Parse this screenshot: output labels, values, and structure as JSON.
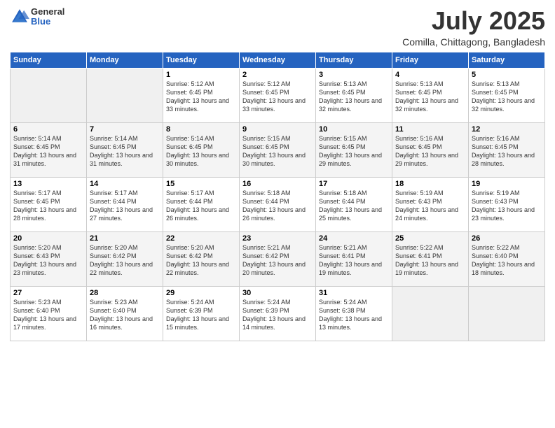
{
  "logo": {
    "general": "General",
    "blue": "Blue"
  },
  "header": {
    "title": "July 2025",
    "subtitle": "Comilla, Chittagong, Bangladesh"
  },
  "days": [
    "Sunday",
    "Monday",
    "Tuesday",
    "Wednesday",
    "Thursday",
    "Friday",
    "Saturday"
  ],
  "weeks": [
    [
      {
        "day": "",
        "sunrise": "",
        "sunset": "",
        "daylight": ""
      },
      {
        "day": "",
        "sunrise": "",
        "sunset": "",
        "daylight": ""
      },
      {
        "day": "1",
        "sunrise": "Sunrise: 5:12 AM",
        "sunset": "Sunset: 6:45 PM",
        "daylight": "Daylight: 13 hours and 33 minutes."
      },
      {
        "day": "2",
        "sunrise": "Sunrise: 5:12 AM",
        "sunset": "Sunset: 6:45 PM",
        "daylight": "Daylight: 13 hours and 33 minutes."
      },
      {
        "day": "3",
        "sunrise": "Sunrise: 5:13 AM",
        "sunset": "Sunset: 6:45 PM",
        "daylight": "Daylight: 13 hours and 32 minutes."
      },
      {
        "day": "4",
        "sunrise": "Sunrise: 5:13 AM",
        "sunset": "Sunset: 6:45 PM",
        "daylight": "Daylight: 13 hours and 32 minutes."
      },
      {
        "day": "5",
        "sunrise": "Sunrise: 5:13 AM",
        "sunset": "Sunset: 6:45 PM",
        "daylight": "Daylight: 13 hours and 32 minutes."
      }
    ],
    [
      {
        "day": "6",
        "sunrise": "Sunrise: 5:14 AM",
        "sunset": "Sunset: 6:45 PM",
        "daylight": "Daylight: 13 hours and 31 minutes."
      },
      {
        "day": "7",
        "sunrise": "Sunrise: 5:14 AM",
        "sunset": "Sunset: 6:45 PM",
        "daylight": "Daylight: 13 hours and 31 minutes."
      },
      {
        "day": "8",
        "sunrise": "Sunrise: 5:14 AM",
        "sunset": "Sunset: 6:45 PM",
        "daylight": "Daylight: 13 hours and 30 minutes."
      },
      {
        "day": "9",
        "sunrise": "Sunrise: 5:15 AM",
        "sunset": "Sunset: 6:45 PM",
        "daylight": "Daylight: 13 hours and 30 minutes."
      },
      {
        "day": "10",
        "sunrise": "Sunrise: 5:15 AM",
        "sunset": "Sunset: 6:45 PM",
        "daylight": "Daylight: 13 hours and 29 minutes."
      },
      {
        "day": "11",
        "sunrise": "Sunrise: 5:16 AM",
        "sunset": "Sunset: 6:45 PM",
        "daylight": "Daylight: 13 hours and 29 minutes."
      },
      {
        "day": "12",
        "sunrise": "Sunrise: 5:16 AM",
        "sunset": "Sunset: 6:45 PM",
        "daylight": "Daylight: 13 hours and 28 minutes."
      }
    ],
    [
      {
        "day": "13",
        "sunrise": "Sunrise: 5:17 AM",
        "sunset": "Sunset: 6:45 PM",
        "daylight": "Daylight: 13 hours and 28 minutes."
      },
      {
        "day": "14",
        "sunrise": "Sunrise: 5:17 AM",
        "sunset": "Sunset: 6:44 PM",
        "daylight": "Daylight: 13 hours and 27 minutes."
      },
      {
        "day": "15",
        "sunrise": "Sunrise: 5:17 AM",
        "sunset": "Sunset: 6:44 PM",
        "daylight": "Daylight: 13 hours and 26 minutes."
      },
      {
        "day": "16",
        "sunrise": "Sunrise: 5:18 AM",
        "sunset": "Sunset: 6:44 PM",
        "daylight": "Daylight: 13 hours and 26 minutes."
      },
      {
        "day": "17",
        "sunrise": "Sunrise: 5:18 AM",
        "sunset": "Sunset: 6:44 PM",
        "daylight": "Daylight: 13 hours and 25 minutes."
      },
      {
        "day": "18",
        "sunrise": "Sunrise: 5:19 AM",
        "sunset": "Sunset: 6:43 PM",
        "daylight": "Daylight: 13 hours and 24 minutes."
      },
      {
        "day": "19",
        "sunrise": "Sunrise: 5:19 AM",
        "sunset": "Sunset: 6:43 PM",
        "daylight": "Daylight: 13 hours and 23 minutes."
      }
    ],
    [
      {
        "day": "20",
        "sunrise": "Sunrise: 5:20 AM",
        "sunset": "Sunset: 6:43 PM",
        "daylight": "Daylight: 13 hours and 23 minutes."
      },
      {
        "day": "21",
        "sunrise": "Sunrise: 5:20 AM",
        "sunset": "Sunset: 6:42 PM",
        "daylight": "Daylight: 13 hours and 22 minutes."
      },
      {
        "day": "22",
        "sunrise": "Sunrise: 5:20 AM",
        "sunset": "Sunset: 6:42 PM",
        "daylight": "Daylight: 13 hours and 22 minutes."
      },
      {
        "day": "23",
        "sunrise": "Sunrise: 5:21 AM",
        "sunset": "Sunset: 6:42 PM",
        "daylight": "Daylight: 13 hours and 20 minutes."
      },
      {
        "day": "24",
        "sunrise": "Sunrise: 5:21 AM",
        "sunset": "Sunset: 6:41 PM",
        "daylight": "Daylight: 13 hours and 19 minutes."
      },
      {
        "day": "25",
        "sunrise": "Sunrise: 5:22 AM",
        "sunset": "Sunset: 6:41 PM",
        "daylight": "Daylight: 13 hours and 19 minutes."
      },
      {
        "day": "26",
        "sunrise": "Sunrise: 5:22 AM",
        "sunset": "Sunset: 6:40 PM",
        "daylight": "Daylight: 13 hours and 18 minutes."
      }
    ],
    [
      {
        "day": "27",
        "sunrise": "Sunrise: 5:23 AM",
        "sunset": "Sunset: 6:40 PM",
        "daylight": "Daylight: 13 hours and 17 minutes."
      },
      {
        "day": "28",
        "sunrise": "Sunrise: 5:23 AM",
        "sunset": "Sunset: 6:40 PM",
        "daylight": "Daylight: 13 hours and 16 minutes."
      },
      {
        "day": "29",
        "sunrise": "Sunrise: 5:24 AM",
        "sunset": "Sunset: 6:39 PM",
        "daylight": "Daylight: 13 hours and 15 minutes."
      },
      {
        "day": "30",
        "sunrise": "Sunrise: 5:24 AM",
        "sunset": "Sunset: 6:39 PM",
        "daylight": "Daylight: 13 hours and 14 minutes."
      },
      {
        "day": "31",
        "sunrise": "Sunrise: 5:24 AM",
        "sunset": "Sunset: 6:38 PM",
        "daylight": "Daylight: 13 hours and 13 minutes."
      },
      {
        "day": "",
        "sunrise": "",
        "sunset": "",
        "daylight": ""
      },
      {
        "day": "",
        "sunrise": "",
        "sunset": "",
        "daylight": ""
      }
    ]
  ]
}
